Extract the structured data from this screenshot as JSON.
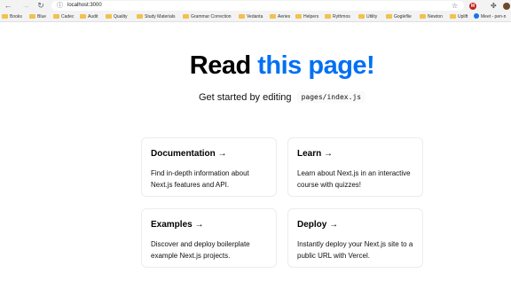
{
  "browser": {
    "url": "localhost:3000",
    "bookmarks": [
      "Books",
      "Blue",
      "Cadec",
      "Audit",
      "Quality",
      "Study Materials",
      "Grammar Correction",
      "Vedanta",
      "Aeries",
      "Helpers",
      "Rythmos",
      "Utility",
      "Gogleflie",
      "Newton",
      "Uplift",
      "Meet - pen-n"
    ],
    "profile_initial": "M"
  },
  "page": {
    "title_prefix": "Read",
    "title_accent": "this page!",
    "accent_color": "#0070f3",
    "description": "Get started by editing",
    "code": "pages/index.js",
    "cards": [
      {
        "title": "Documentation →",
        "text": "Find in-depth information about Next.js features and API."
      },
      {
        "title": "Learn →",
        "text": "Learn about Next.js in an interactive course with quizzes!"
      },
      {
        "title": "Examples →",
        "text": "Discover and deploy boilerplate example Next.js projects."
      },
      {
        "title": "Deploy →",
        "text": "Instantly deploy your Next.js site to a public URL with Vercel."
      }
    ]
  }
}
